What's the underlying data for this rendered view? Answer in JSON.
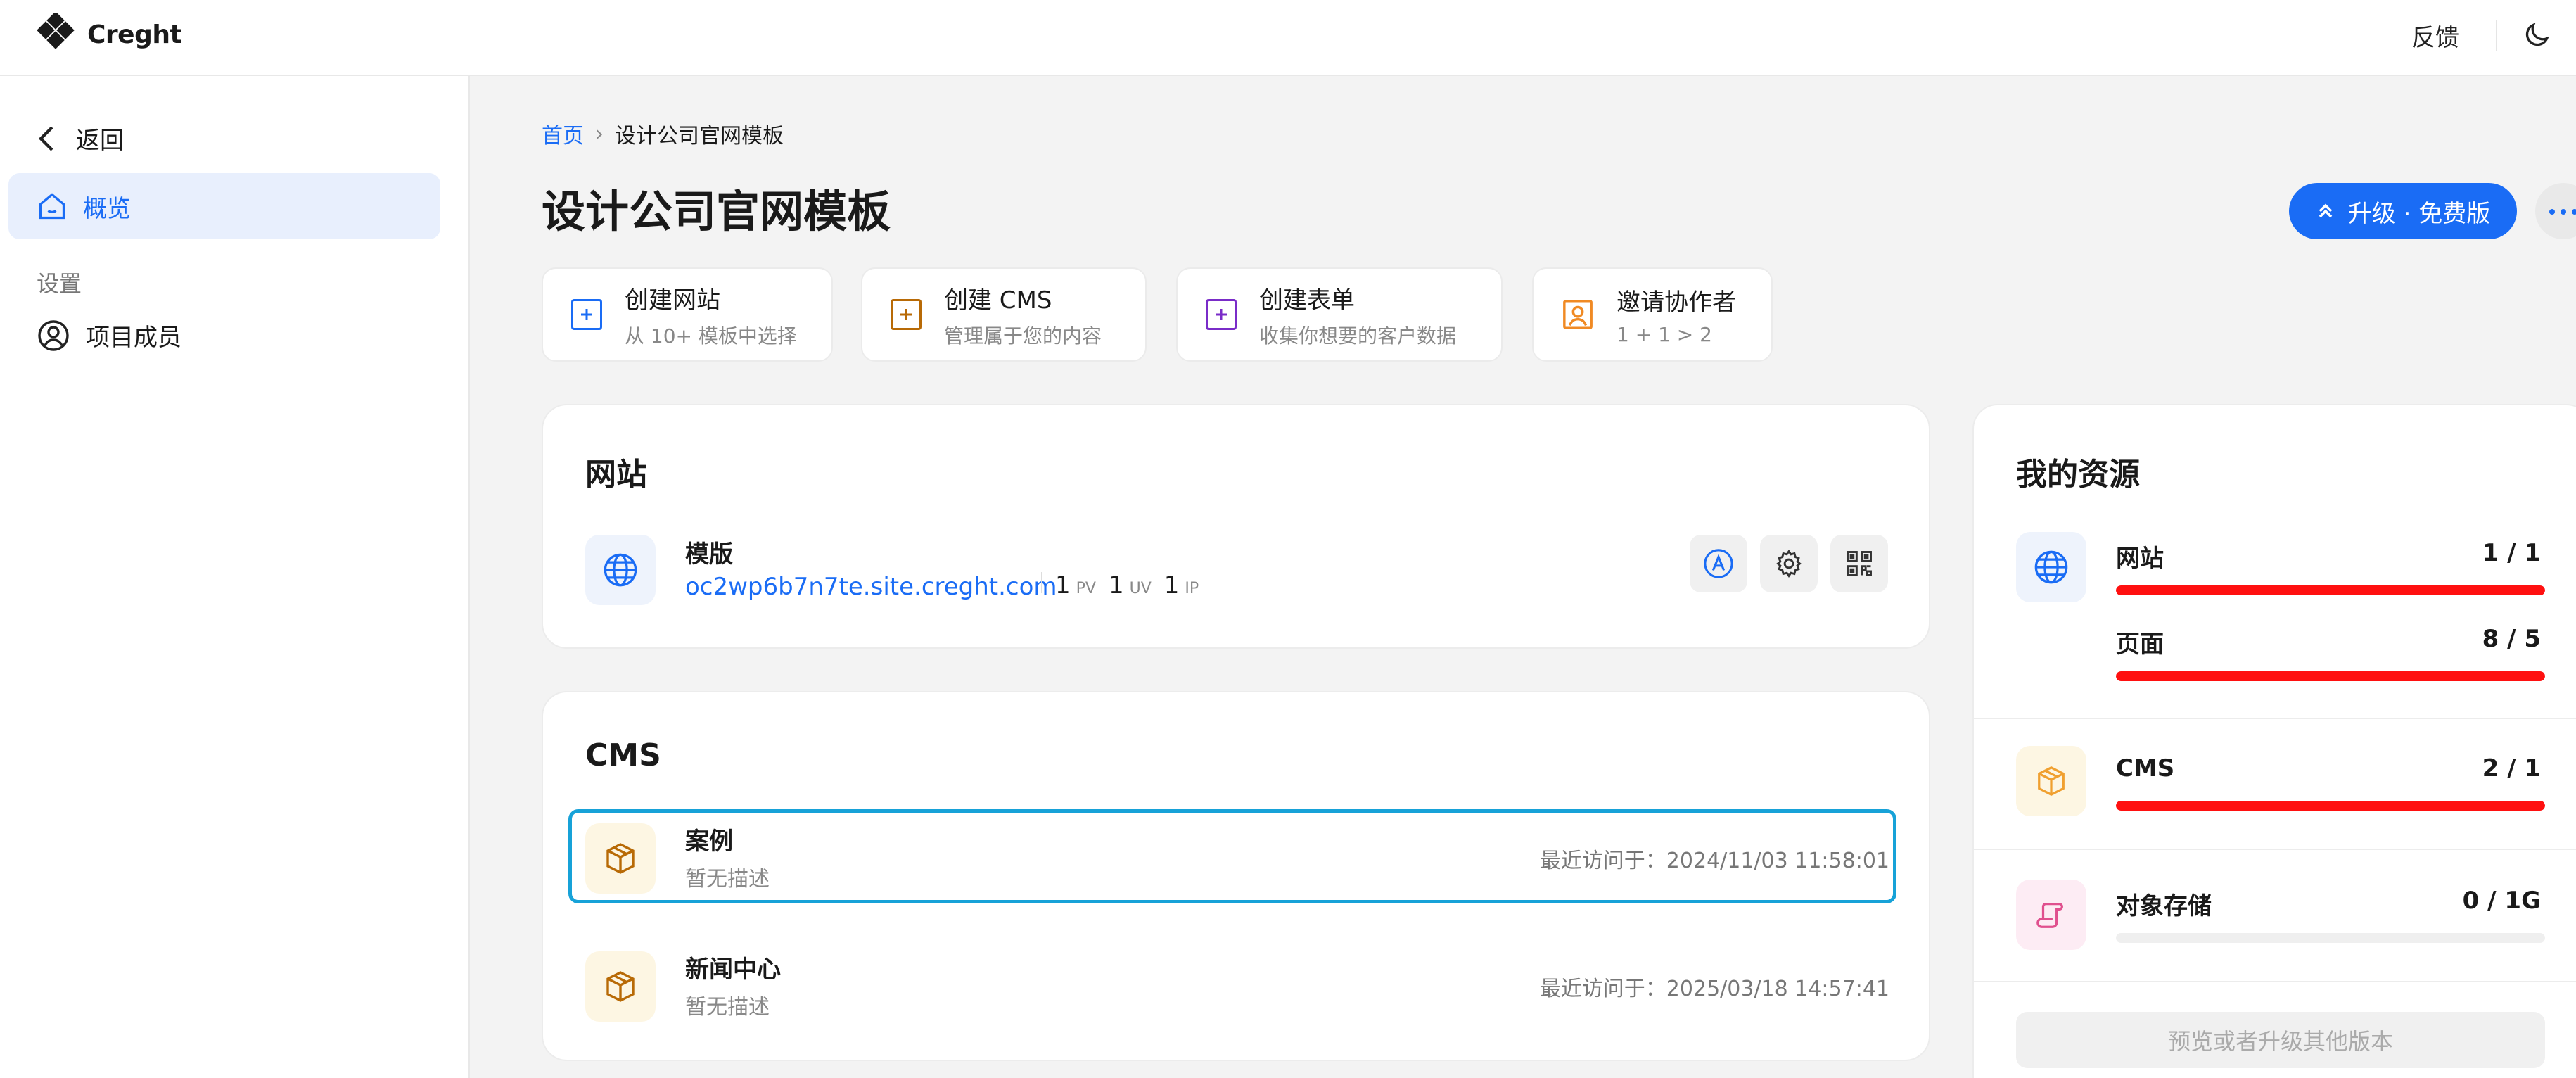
{
  "app": {
    "name": "Creght"
  },
  "topbar": {
    "feedback": "反馈"
  },
  "sidebar": {
    "back": "返回",
    "overview": "概览",
    "section_settings": "设置",
    "members": "项目成员"
  },
  "breadcrumb": {
    "home": "首页",
    "current": "设计公司官网模板"
  },
  "page": {
    "title": "设计公司官网模板"
  },
  "upgrade": {
    "label": "升级 · 免费版"
  },
  "quick_actions": [
    {
      "title": "创建网站",
      "sub": "从 10+ 模板中选择",
      "color": "#1a6cf5"
    },
    {
      "title": "创建 CMS",
      "sub": "管理属于您的内容",
      "color": "#b86a06"
    },
    {
      "title": "创建表单",
      "sub": "收集你想要的客户数据",
      "color": "#7a2cc8"
    },
    {
      "title": "邀请协作者",
      "sub": "1 + 1 > 2",
      "color": "#f08a24"
    }
  ],
  "website": {
    "title": "网站",
    "name": "模版",
    "url": "oc2wp6b7n7te.site.creght.com",
    "stats": [
      {
        "value": "1",
        "unit": "PV"
      },
      {
        "value": "1",
        "unit": "UV"
      },
      {
        "value": "1",
        "unit": "IP"
      }
    ]
  },
  "cms": {
    "title": "CMS",
    "items": [
      {
        "name": "案例",
        "desc": "暂无描述",
        "visited": "最近访问于：2024/11/03 11:58:01"
      },
      {
        "name": "新闻中心",
        "desc": "暂无描述",
        "visited": "最近访问于：2025/03/18 14:57:41"
      }
    ]
  },
  "resources": {
    "title": "我的资源",
    "items": [
      {
        "label": "网站",
        "value": "1 / 1",
        "fraction": 1.0
      },
      {
        "label": "页面",
        "value": "8 / 5",
        "fraction": 1.0
      },
      {
        "label": "CMS",
        "value": "2 / 1",
        "fraction": 1.0
      },
      {
        "label": "对象存储",
        "value": "0 / 1G",
        "fraction": 0.0
      }
    ],
    "preview_button": "预览或者升级其他版本"
  },
  "colors": {
    "accent": "#1a6cf5",
    "danger": "#ff1010",
    "highlight": "#17a2d8"
  }
}
